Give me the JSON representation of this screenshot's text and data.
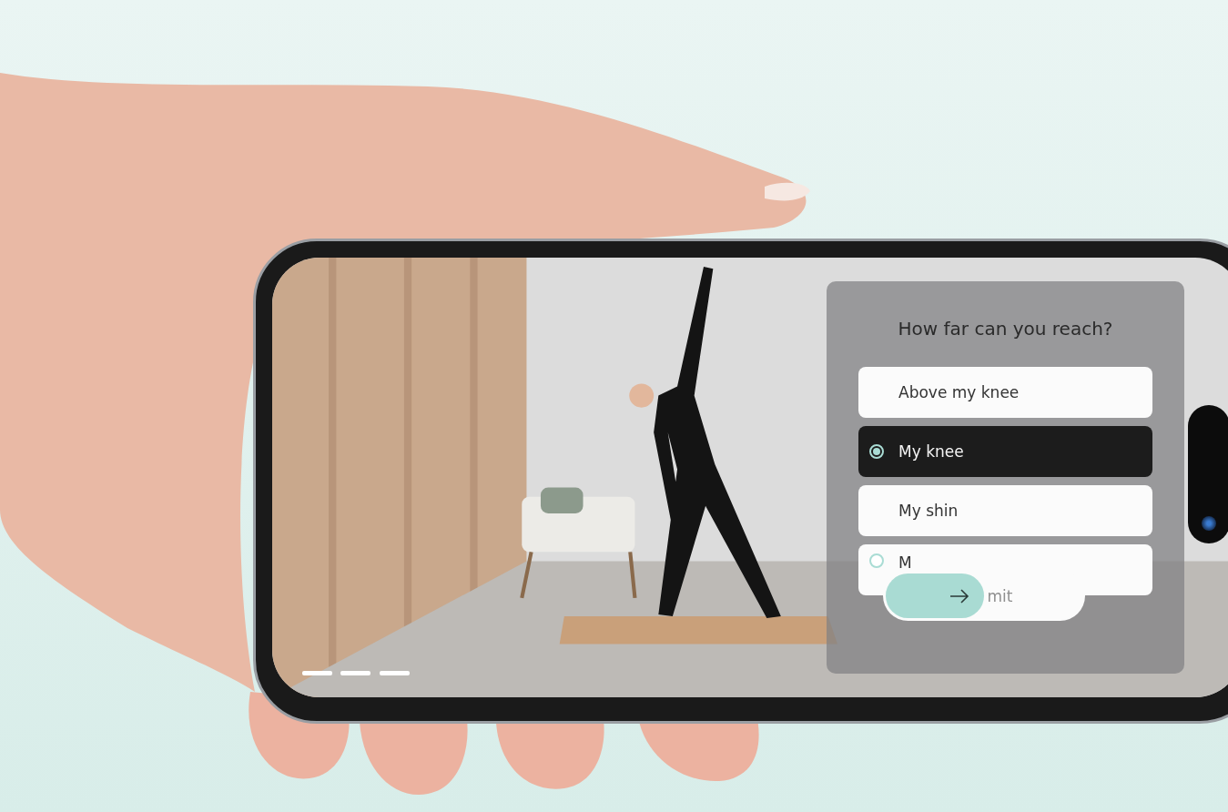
{
  "quiz": {
    "question": "How far can you reach?",
    "options": [
      {
        "label": "Above my knee",
        "kind": "plain",
        "selected": false
      },
      {
        "label": "My knee",
        "kind": "radio",
        "selected": true
      },
      {
        "label": "My shin",
        "kind": "plain",
        "selected": false
      },
      {
        "label": "M",
        "kind": "radio",
        "selected": false
      }
    ],
    "submit": {
      "label": "mit",
      "level": 0.5
    }
  }
}
